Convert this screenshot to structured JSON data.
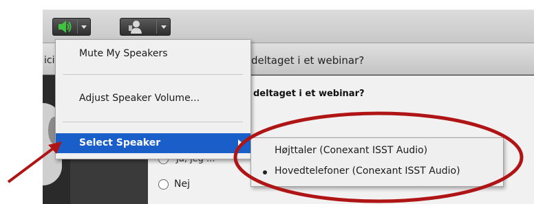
{
  "pod": {
    "header_left_partial": "ici",
    "question_title": "deltaget i et webinar?",
    "question_text": "deltaget i et webinar?",
    "option_partial": "Ja, jeg ...",
    "option_no": "Nej"
  },
  "toolbar": {
    "speaker_icon": "speaker-icon",
    "webcam_icon": "webcam-icon"
  },
  "menu": {
    "mute": "Mute My Speakers",
    "adjust": "Adjust Speaker Volume...",
    "select": "Select Speaker"
  },
  "submenu": {
    "items": [
      {
        "label": "Højttaler (Conexant ISST Audio)",
        "selected": false
      },
      {
        "label": "Hovedtelefoner (Conexant ISST Audio)",
        "selected": true
      }
    ]
  },
  "colors": {
    "highlight": "#1a5fc9",
    "annotation": "#b01515",
    "speaker_green": "#3ec43e"
  }
}
